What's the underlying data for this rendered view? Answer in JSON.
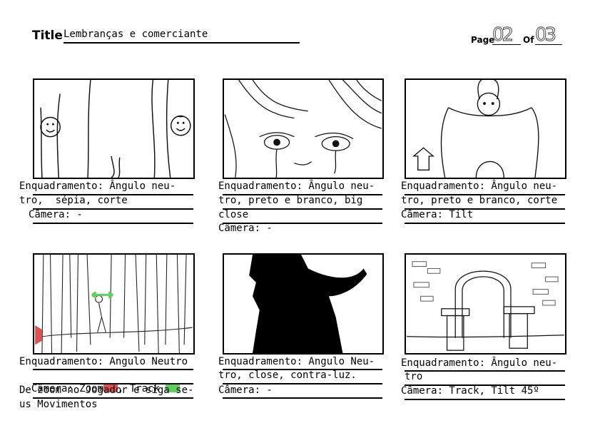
{
  "header": {
    "title_label": "Title",
    "title_value": "Lembranças e comerciante",
    "page_label": "Page",
    "page_number": "02",
    "of_label": "Of",
    "page_total": "03"
  },
  "colors": {
    "zoom_marker": "#e05050",
    "track_marker": "#5ccf5c",
    "arrow_green": "#5ccf5c",
    "frame_red": "#e05050"
  },
  "panels": [
    {
      "lines": [
        "Enquadramento: Ângulo neu-",
        "tro,  sépia, corte",
        "Câmera: -"
      ]
    },
    {
      "lines": [
        "Enquadramento: Ângulo neu-",
        "tro, preto e branco, big",
        "close",
        "Câmera: -"
      ]
    },
    {
      "lines": [
        "Enquadramento: Ângulo neu-",
        "tro, preto e branco, corte",
        "Câmera: Tilt"
      ]
    },
    {
      "lines": [
        "Enquadramento: Angulo Neutro",
        "Câmera: Zoom",
        ", Track",
        "De zoom no Jogador e siga se-",
        "us Movimentos"
      ]
    },
    {
      "lines": [
        "Enquadramento: Angulo Neu-",
        "tro, close, contra-luz.",
        "Câmera: -"
      ]
    },
    {
      "lines": [
        "Enquadramento: Ângulo neu-",
        "tro",
        "Câmera: Track, Tilt 45º"
      ]
    }
  ]
}
